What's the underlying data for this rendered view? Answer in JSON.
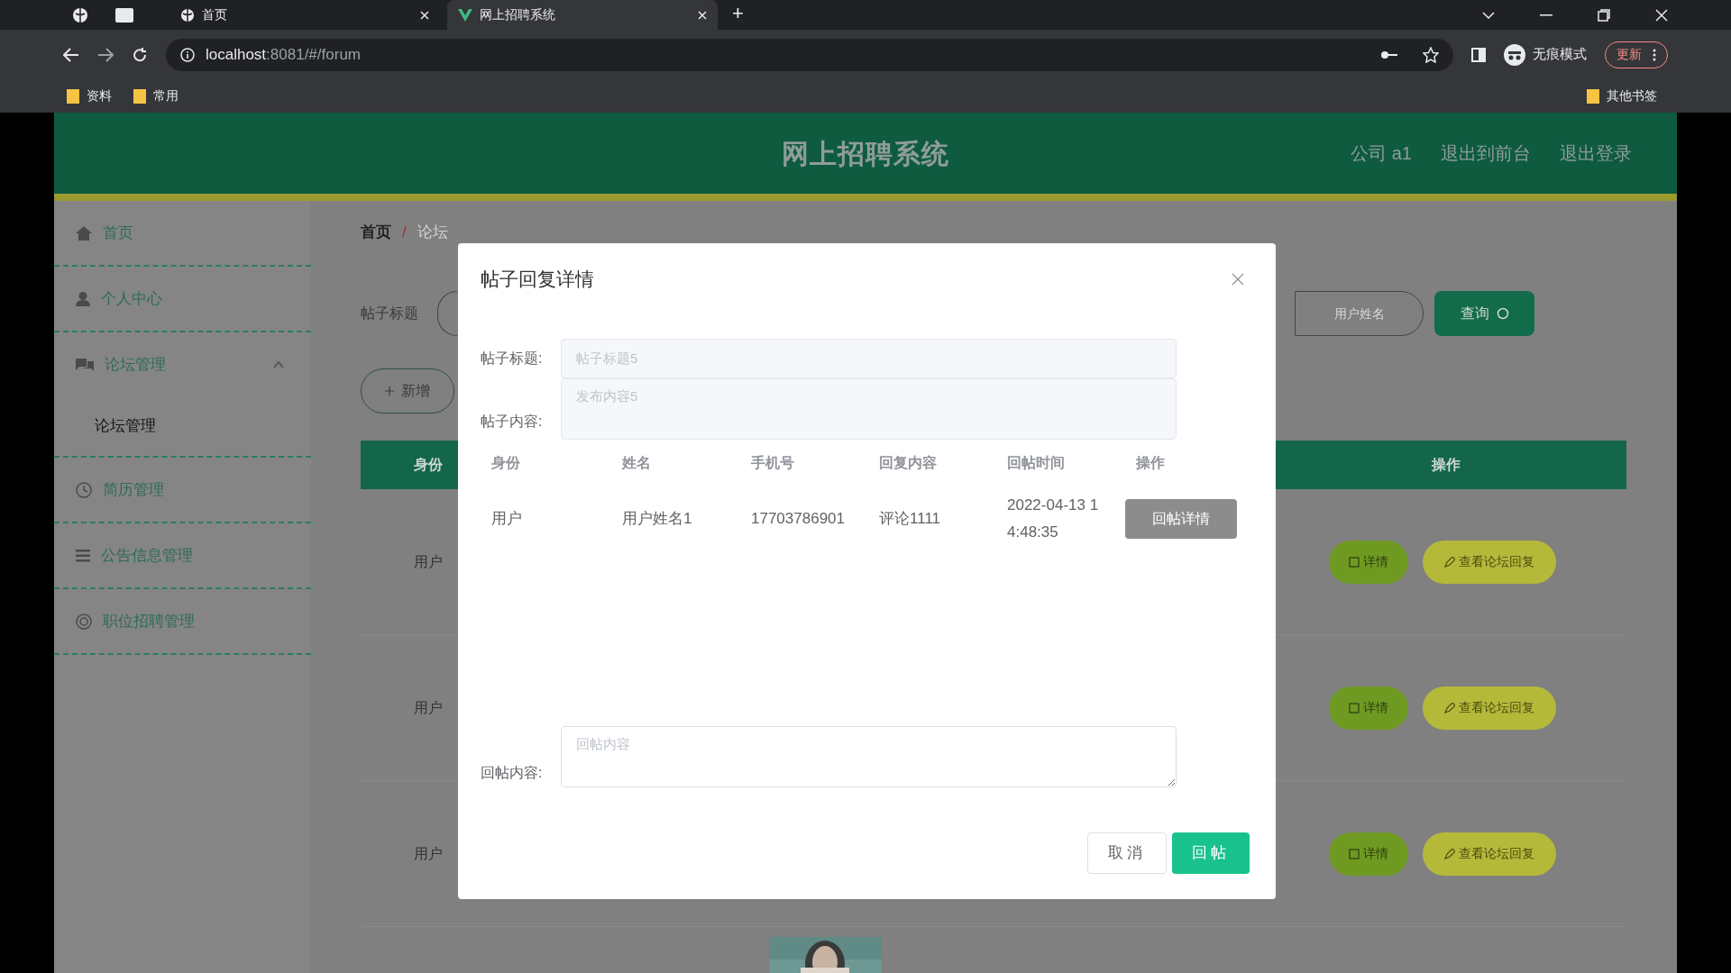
{
  "browser": {
    "tabs": [
      {
        "title": "首页",
        "selected": false
      },
      {
        "title": "网上招聘系统",
        "selected": true
      }
    ],
    "new_tab": "+",
    "address_host": "localhost",
    "address_rest": ":8081/#/forum",
    "incognito_label": "无痕模式",
    "update_button": "更新",
    "bookmarks": [
      "资料",
      "常用"
    ],
    "other_bookmarks": "其他书签"
  },
  "header": {
    "title": "网上招聘系统",
    "links": [
      "公司 a1",
      "退出到前台",
      "退出登录"
    ]
  },
  "sidebar": {
    "items": [
      {
        "label": "首页",
        "kind": "home"
      },
      {
        "label": "个人中心",
        "kind": "user"
      },
      {
        "label": "论坛管理",
        "kind": "forum",
        "expanded": true,
        "children": [
          {
            "label": "论坛管理"
          }
        ]
      },
      {
        "label": "简历管理",
        "kind": "resume"
      },
      {
        "label": "公告信息管理",
        "kind": "list"
      },
      {
        "label": "职位招聘管理",
        "kind": "job"
      }
    ]
  },
  "breadcrumb": {
    "items": [
      "首页",
      "论坛"
    ],
    "separator": "/"
  },
  "search": {
    "label": "帖子标题",
    "name_placeholder": "用户姓名",
    "button": "查询"
  },
  "add_button": "新增",
  "table": {
    "columns": [
      "身份",
      "操作"
    ],
    "rows": [
      {
        "identity": "用户",
        "actions": [
          "详情",
          "查看论坛回复"
        ]
      },
      {
        "identity": "用户",
        "actions": [
          "详情",
          "查看论坛回复"
        ]
      },
      {
        "identity": "用户",
        "actions": [
          "详情",
          "查看论坛回复"
        ]
      }
    ]
  },
  "modal": {
    "title": "帖子回复详情",
    "fields": [
      {
        "label": "帖子标题:",
        "value": "帖子标题5",
        "kind": "input",
        "disabled": true
      },
      {
        "label": "帖子内容:",
        "value": "发布内容5",
        "kind": "textarea",
        "disabled": true
      }
    ],
    "reply_table": {
      "columns": [
        "身份",
        "姓名",
        "手机号",
        "回复内容",
        "回帖时间",
        "操作"
      ],
      "rows": [
        {
          "cells": [
            "用户",
            "用户姓名1",
            "17703786901",
            "评论1111",
            "2022-04-13 14:48:35"
          ],
          "action": "回帖详情"
        }
      ]
    },
    "reply_field": {
      "label": "回帖内容:",
      "placeholder": "回帖内容"
    },
    "buttons": [
      {
        "label": "取消",
        "kind": "default"
      },
      {
        "label": "回帖",
        "kind": "primary"
      }
    ]
  }
}
